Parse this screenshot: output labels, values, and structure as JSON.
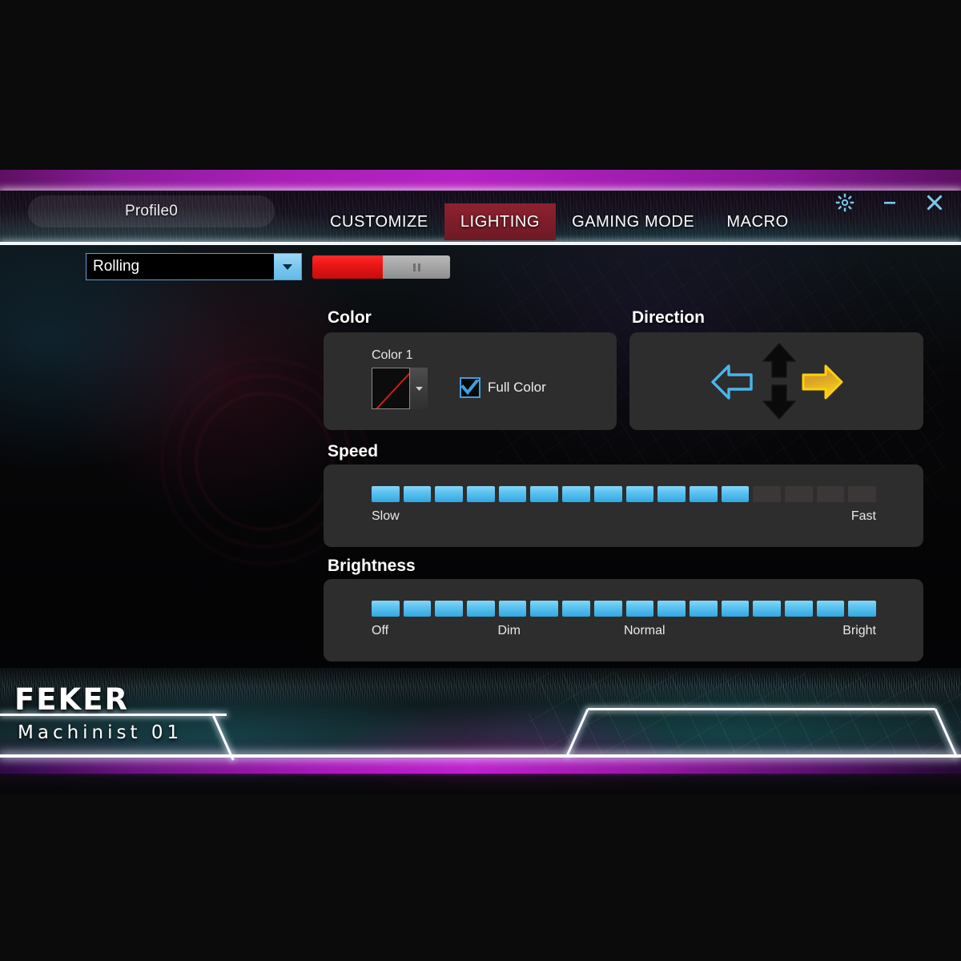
{
  "window": {
    "profile_label": "Profile0",
    "controls": [
      {
        "name": "settings-button",
        "icon": "gear-icon"
      },
      {
        "name": "minimize-button",
        "icon": "minimize-icon"
      },
      {
        "name": "close-button",
        "icon": "close-icon"
      }
    ]
  },
  "tabs": [
    {
      "label": "CUSTOMIZE",
      "active": false
    },
    {
      "label": "LIGHTING",
      "active": true
    },
    {
      "label": "GAMING MODE",
      "active": false
    },
    {
      "label": "MACRO",
      "active": false
    }
  ],
  "toolbar": {
    "effect_select": {
      "value": "Rolling",
      "options": [
        "Rolling"
      ]
    },
    "preview": {
      "red_label": "",
      "state_icon": "pause-icon"
    }
  },
  "color_section": {
    "title": "Color",
    "color_label": "Color 1",
    "swatch_value": "none",
    "swatch_stroke": "#d01b1b",
    "full_color_label": "Full Color",
    "full_color_checked": true,
    "checkbox_accent": "#3f9fe0"
  },
  "direction_section": {
    "title": "Direction",
    "selected": "right",
    "arrows": [
      {
        "name": "direction-left-arrow",
        "state": "available",
        "color": "#49b6ec"
      },
      {
        "name": "direction-up-arrow",
        "state": "disabled",
        "color": "#0b0b0b"
      },
      {
        "name": "direction-down-arrow",
        "state": "disabled",
        "color": "#0b0b0b"
      },
      {
        "name": "direction-right-arrow",
        "state": "selected",
        "color": "#f2a81c"
      }
    ]
  },
  "speed_section": {
    "title": "Speed",
    "total_segments": 16,
    "filled_segments": 12,
    "labels": [
      "Slow",
      "Fast"
    ]
  },
  "brightness_section": {
    "title": "Brightness",
    "total_segments": 16,
    "filled_segments": 16,
    "labels": [
      "Off",
      "Dim",
      "Normal",
      "Bright"
    ]
  },
  "branding": {
    "name": "FEKER",
    "model": "Machinist 01"
  },
  "theme": {
    "accent_blue": "#5cc3f0",
    "accent_magenta": "#c021ce",
    "active_tab_red": "#8e2130",
    "panel_bg": "#2d2d2d"
  }
}
